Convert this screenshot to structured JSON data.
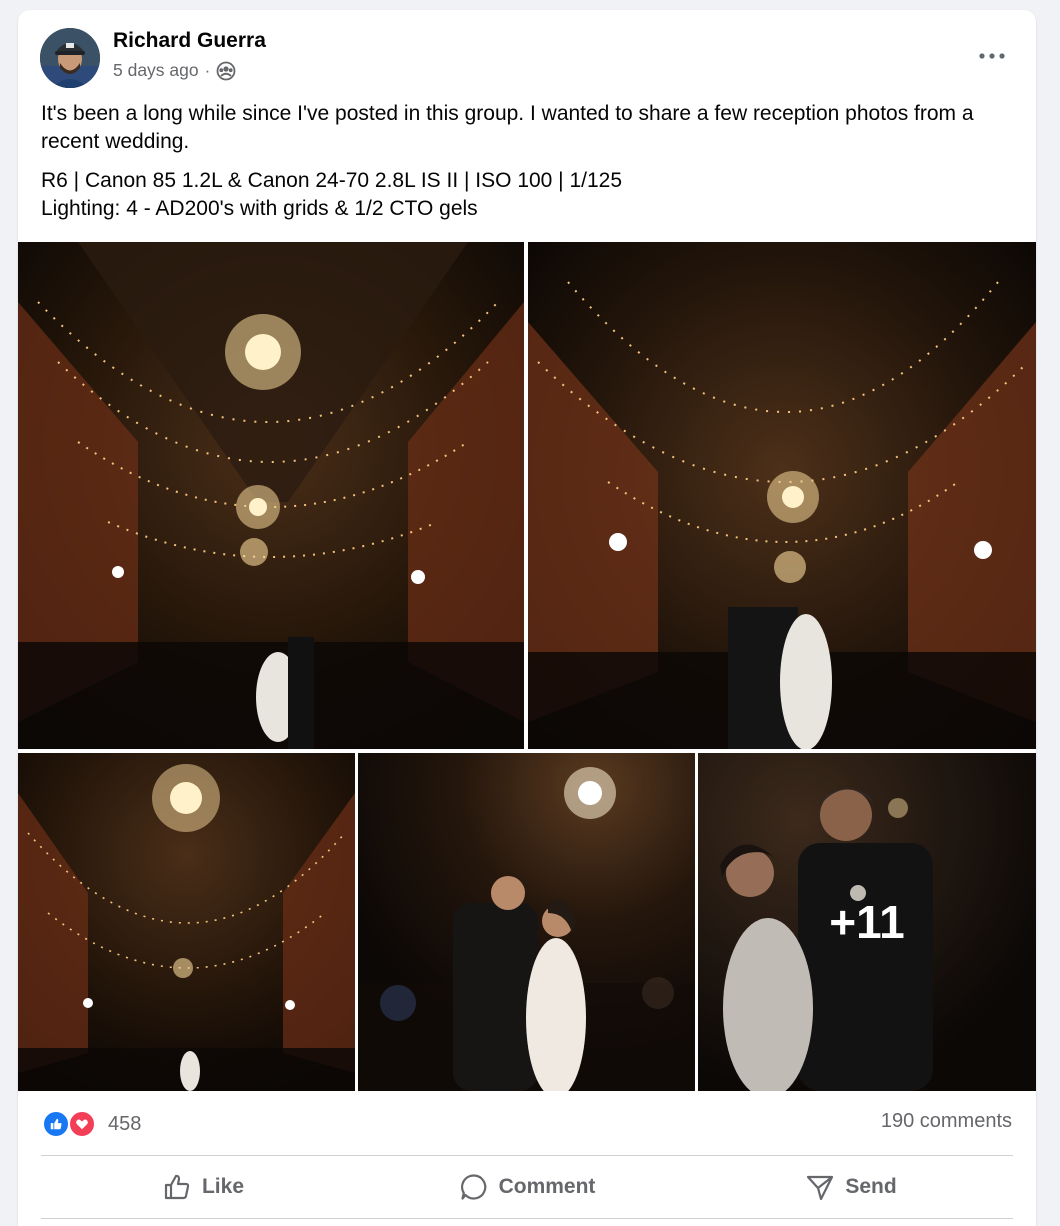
{
  "post": {
    "author": "Richard Guerra",
    "time": "5 days ago",
    "separator": "·",
    "audience_icon": "group-icon",
    "more_icon": "more-horizontal-icon",
    "text_intro": "It's been a long while since I've posted in this group. I wanted to share a few reception photos from a recent wedding.",
    "gear_line": "R6 | Canon 85 1.2L & Canon 24-70 2.8L IS II | ISO 100 | 1/125",
    "lighting_line": "Lighting: 4 - AD200's with grids & 1/2 CTO gels"
  },
  "photos": {
    "more_count": "+11"
  },
  "engagement": {
    "reaction_icons": [
      "like-icon",
      "love-icon"
    ],
    "reaction_count": "458",
    "comments": "190 comments"
  },
  "actions": {
    "like": "Like",
    "comment": "Comment",
    "send": "Send"
  },
  "colors": {
    "background": "#f0f2f5",
    "card": "#ffffff",
    "like_blue": "#1877f2",
    "love_red": "#f33e58",
    "secondary_text": "#65676b"
  }
}
